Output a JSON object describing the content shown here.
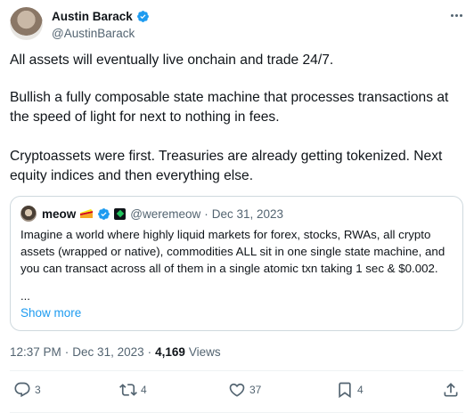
{
  "author": {
    "name": "Austin Barack",
    "handle": "@AustinBarack",
    "verified": true
  },
  "tweet": {
    "paragraphs": [
      "All assets will eventually live onchain and trade 24/7.",
      "Bullish a fully composable state machine that processes transactions at the speed of light for next to nothing in fees.",
      "Cryptoassets were first. Treasuries are already getting tokenized. Next equity indices and then everything else."
    ]
  },
  "quote": {
    "name": "meow",
    "handle": "@weremeow",
    "separator": "·",
    "date": "Dec 31, 2023",
    "text": "Imagine a world where highly liquid markets for forex, stocks, RWAs, all crypto assets (wrapped or native), commodities ALL sit in one single state machine, and you can transact across all of them in a single atomic txn taking 1 sec & $0.002.",
    "ellipsis": "...",
    "show_more": "Show more"
  },
  "meta": {
    "time": "12:37 PM",
    "sep1": "·",
    "date": "Dec 31, 2023",
    "sep2": "·",
    "views_count": "4,169",
    "views_label": "Views"
  },
  "actions": {
    "replies": "3",
    "reposts": "4",
    "likes": "37",
    "bookmarks": "4"
  },
  "colors": {
    "accent": "#1d9bf0",
    "text": "#0f1419",
    "secondary": "#536471",
    "border": "#cfd9de"
  },
  "icons": [
    "more-icon",
    "verified-icon",
    "reply-icon",
    "repost-icon",
    "like-icon",
    "bookmark-icon",
    "share-icon"
  ]
}
